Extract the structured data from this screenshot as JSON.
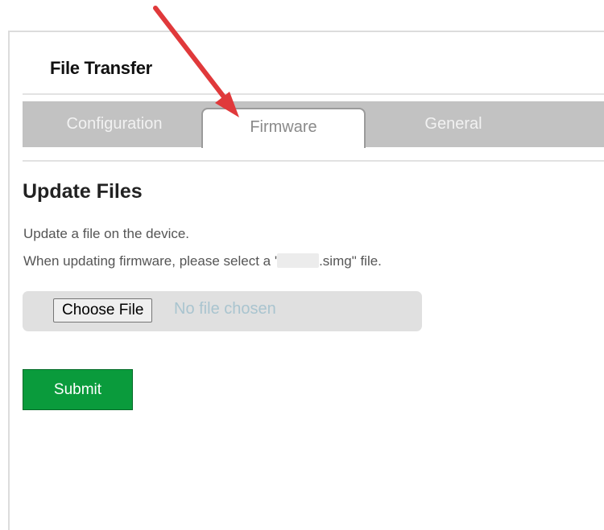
{
  "header": {
    "title": "File Transfer"
  },
  "tabs": [
    {
      "label": "Configuration",
      "active": false
    },
    {
      "label": "Firmware",
      "active": true
    },
    {
      "label": "General",
      "active": false
    }
  ],
  "section": {
    "heading": "Update Files",
    "line1": "Update a file on the device.",
    "line2_prefix": "When updating firmware, please select a '",
    "line2_suffix": ".simg\" file."
  },
  "file_input": {
    "button_label": "Choose File",
    "status": "No file chosen"
  },
  "submit_label": "Submit",
  "colors": {
    "tab_bar": "#c2c2c2",
    "submit_green": "#0a9b3c",
    "annotation_arrow": "#e0393b"
  },
  "annotation": {
    "icon": "red-arrow-icon"
  }
}
